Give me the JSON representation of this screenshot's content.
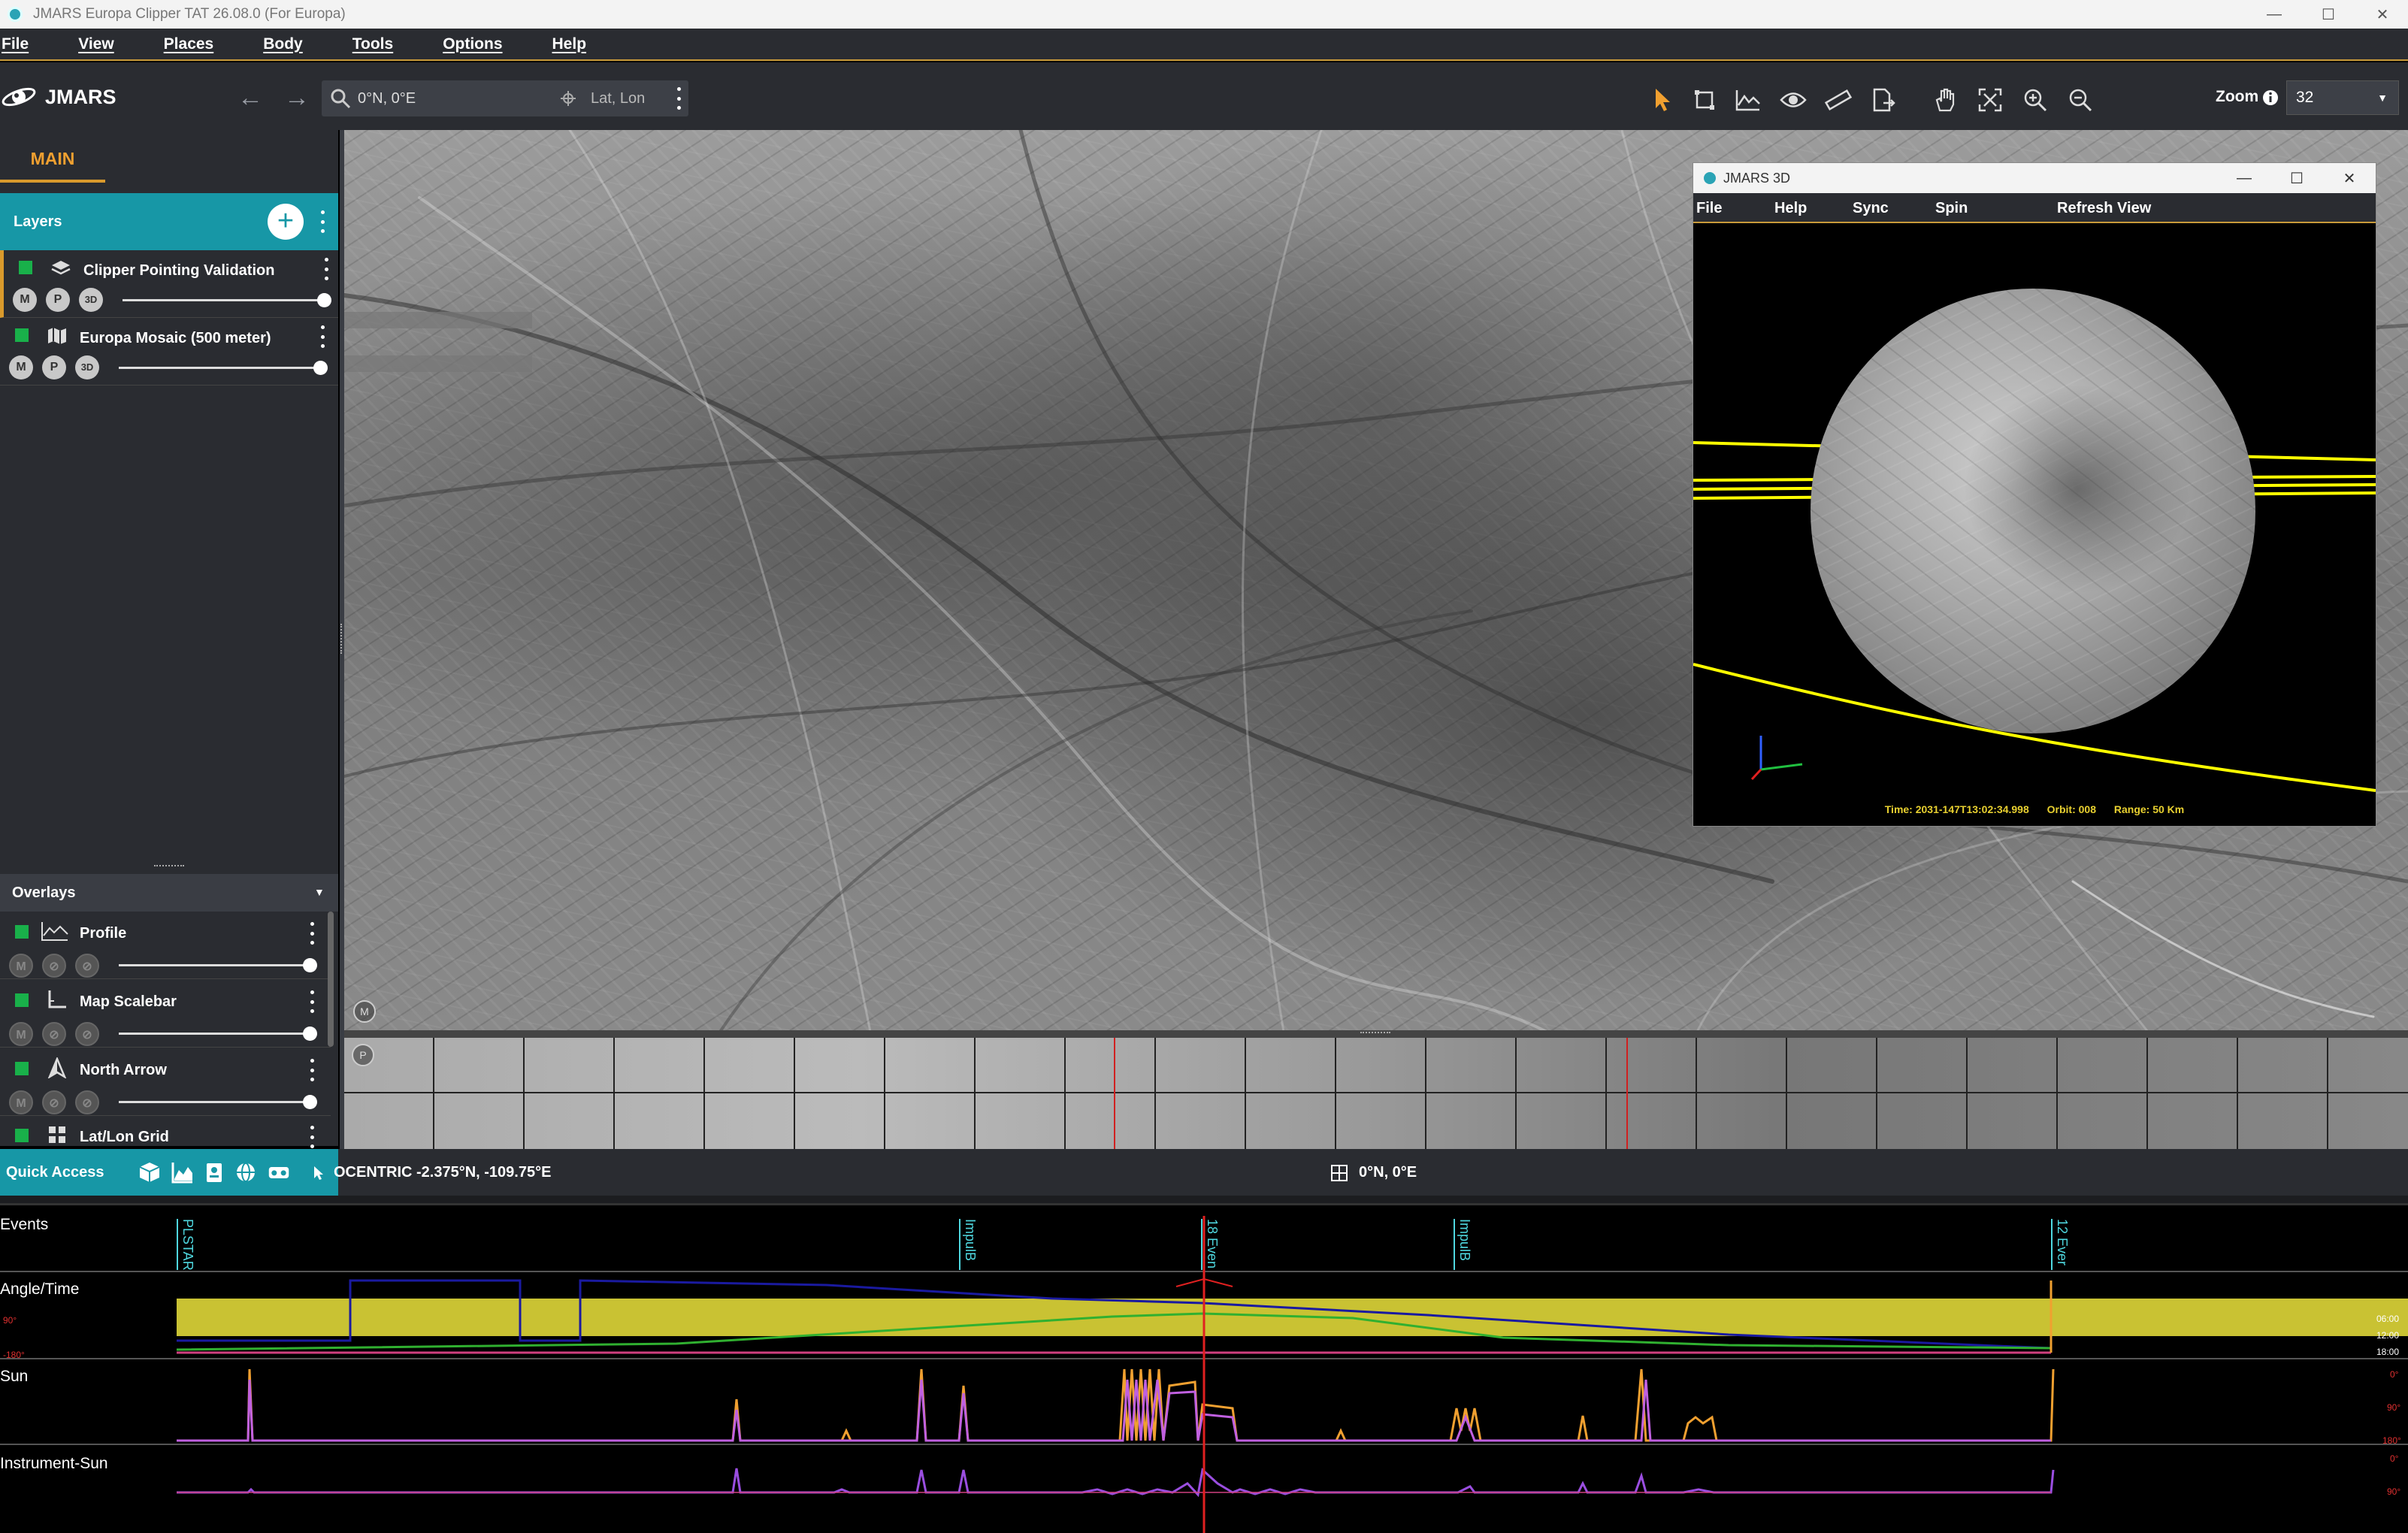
{
  "window": {
    "title": "JMARS Europa Clipper TAT 26.08.0 (For Europa)",
    "minimize": "—",
    "maximize": "☐",
    "close": "✕"
  },
  "menu": [
    "File",
    "View",
    "Places",
    "Body",
    "Tools",
    "Options",
    "Help"
  ],
  "toolbar": {
    "app_name": "JMARS",
    "back_icon": "arrow-left-icon",
    "forward_icon": "arrow-right-icon",
    "search_value": "0°N, 0°E",
    "search_mode": "Lat, Lon",
    "zoom_label": "Zoom",
    "zoom_value": "32",
    "accent_color": "#f0a030"
  },
  "left_panel": {
    "tab": "MAIN",
    "layers_title": "Layers",
    "layers": [
      {
        "name": "Clipper Pointing Validation",
        "buttons": [
          "M",
          "P",
          "3D"
        ],
        "opacity": 1.0
      },
      {
        "name": "Europa Mosaic (500 meter)",
        "buttons": [
          "M",
          "P",
          "3D"
        ],
        "opacity": 1.0
      }
    ],
    "overlays_title": "Overlays",
    "overlays": [
      {
        "name": "Profile",
        "opacity": 1.0
      },
      {
        "name": "Map Scalebar",
        "opacity": 1.0
      },
      {
        "name": "North Arrow",
        "opacity": 1.0
      },
      {
        "name": "Lat/Lon Grid",
        "opacity": 1.0
      }
    ],
    "overlay_buttons": [
      "M",
      "P",
      "3D"
    ]
  },
  "map": {
    "main_marker": "M",
    "panner_marker": "P"
  },
  "jmars3d": {
    "title": "JMARS 3D",
    "menu": [
      "File",
      "Help",
      "Sync",
      "Spin",
      "Refresh View"
    ],
    "time": "Time: 2031-147T13:02:34.998",
    "orbit": "Orbit: 008",
    "range": "Range: 50 Km",
    "track_color": "#ffff00"
  },
  "status": {
    "quick_access": "Quick Access",
    "coordinates": "OCENTRIC  -2.375°N, -109.75°E",
    "grid_coords": "0°N, 0°E"
  },
  "timeline": {
    "tracks": [
      "Events",
      "Angle/Time",
      "Sun",
      "Instrument-Sun"
    ],
    "event_labels": [
      "PLSTAR",
      "ImpulB",
      "18 Even",
      "ImpulB",
      "12 Ever"
    ],
    "angle_ticks": [
      "90°",
      "-180°"
    ],
    "right_ticks": [
      "06:00",
      "12:00",
      "18:00",
      "0°",
      "90°",
      "180°"
    ],
    "band_color": "#c9c233"
  }
}
